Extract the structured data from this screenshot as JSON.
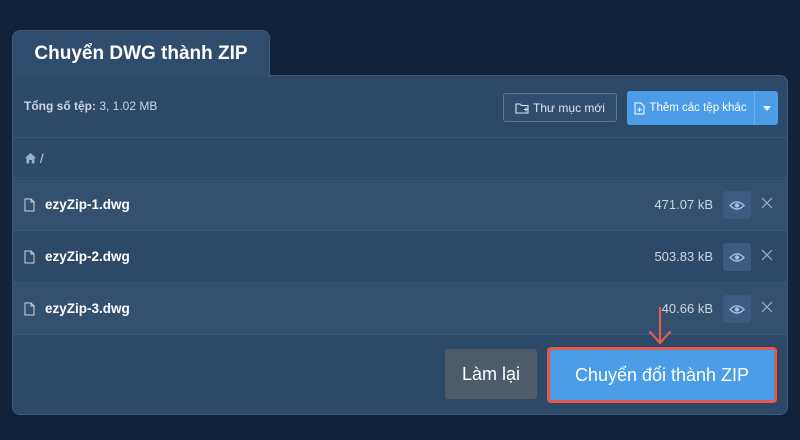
{
  "tab": {
    "title": "Chuyển DWG thành ZIP"
  },
  "toolbar": {
    "total_label": "Tổng số tệp:",
    "total_value": " 3, 1.02 MB",
    "new_folder_label": "Thư mục mới",
    "add_files_label": "Thêm các tệp khác"
  },
  "breadcrumb": {
    "separator": "/"
  },
  "files": [
    {
      "name": "ezyZip-1.dwg",
      "size": "471.07 kB"
    },
    {
      "name": "ezyZip-2.dwg",
      "size": "503.83 kB"
    },
    {
      "name": "ezyZip-3.dwg",
      "size": "40.66 kB"
    }
  ],
  "actions": {
    "reset_label": "Làm lại",
    "convert_label": "Chuyển đổi thành ZIP"
  },
  "colors": {
    "background": "#11233a",
    "panel": "#2d4968",
    "accent": "#4a9de6",
    "highlight": "#e25b50"
  },
  "icons": [
    "home-icon",
    "folder-plus-icon",
    "file-plus-icon",
    "file-icon",
    "eye-icon",
    "close-icon",
    "arrow-down-icon"
  ]
}
